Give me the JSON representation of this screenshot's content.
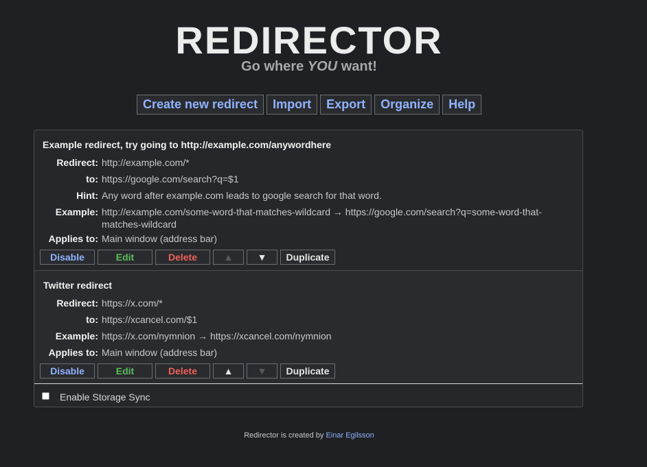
{
  "header": {
    "title": "REDIRECTOR",
    "subtitle_pre": "Go where",
    "subtitle_em": "YOU",
    "subtitle_post": "want!"
  },
  "menu": {
    "create": "Create new redirect",
    "import": "Import",
    "export": "Export",
    "organize": "Organize",
    "help": "Help"
  },
  "labels": {
    "redirect": "Redirect:",
    "to": "to:",
    "hint": "Hint:",
    "example": "Example:",
    "applies": "Applies to:"
  },
  "buttons": {
    "disable": "Disable",
    "edit": "Edit",
    "delete": "Delete",
    "up": "▲",
    "down": "▼",
    "duplicate": "Duplicate"
  },
  "redirects": [
    {
      "title": "Example redirect, try going to http://example.com/anywordhere",
      "redirect": "http://example.com/*",
      "to": "https://google.com/search?q=$1",
      "hint": "Any word after example.com leads to google search for that word.",
      "example": "http://example.com/some-word-that-matches-wildcard → https://google.com/search?q=some-word-that-matches-wildcard",
      "applies": "Main window (address bar)"
    },
    {
      "title": "Twitter redirect",
      "redirect": "https://x.com/*",
      "to": "https://xcancel.com/$1",
      "example": "https://x.com/nymnion → https://xcancel.com/nymnion",
      "applies": "Main window (address bar)"
    }
  ],
  "sync": {
    "label": "Enable Storage Sync",
    "checked": false
  },
  "footer": {
    "text": "Redirector is created by",
    "author": "Einar Egilsson"
  },
  "colors": {
    "background": "#1f2023",
    "link": "#8fb3ff",
    "edit": "#5bbd5b",
    "delete": "#f0605a"
  }
}
